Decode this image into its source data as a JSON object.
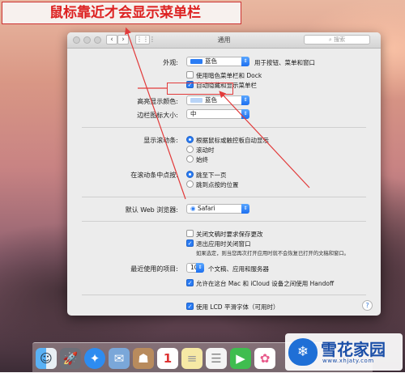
{
  "annotation": {
    "banner_text": "鼠标靠近才会显示菜单栏"
  },
  "window": {
    "title": "通用",
    "search_placeholder": "搜索"
  },
  "appearance": {
    "label": "外观:",
    "value": "蓝色",
    "hint": "用于按钮、菜单和窗口",
    "accent": "#2a7cf4"
  },
  "dark_menu_checkbox": {
    "label": "使用暗色菜单栏和 Dock",
    "checked": false
  },
  "autohide_checkbox": {
    "label": "自动隐藏和显示菜单栏",
    "checked": true
  },
  "highlight": {
    "label": "高亮显示颜色:",
    "value": "蓝色",
    "swatch": "#b9d4f7"
  },
  "sidebar_icon_size": {
    "label": "边栏图标大小:",
    "value": "中"
  },
  "scrollbars": {
    "label": "显示滚动条:",
    "options": [
      "根据鼠标或触控板自动显示",
      "滚动时",
      "始终"
    ],
    "selected": 0
  },
  "click_scrollbar": {
    "label": "在滚动条中点按:",
    "options": [
      "跳至下一页",
      "跳到点按的位置"
    ],
    "selected": 0
  },
  "browser": {
    "label": "默认 Web 浏览器:",
    "value": "Safari"
  },
  "ask_keep_changes": {
    "label": "关闭文稿时要求保存更改",
    "checked": false
  },
  "close_windows": {
    "label": "退出应用时关闭窗口",
    "checked": true,
    "note": "如果选定，则当您再次打开应用时就不会恢复已打开的文稿和窗口。"
  },
  "recent_items": {
    "label": "最近使用的项目:",
    "value": "10",
    "suffix": "个文稿、应用和服务器"
  },
  "handoff": {
    "label": "允许在这台 Mac 和 iCloud 设备之间使用 Handoff",
    "checked": true
  },
  "lcd_smoothing": {
    "label": "使用 LCD 平滑字体（可用时）",
    "checked": true
  },
  "help_button": {
    "label": "?"
  },
  "dock": {
    "icons": [
      "finder-icon",
      "launchpad-icon",
      "safari-icon",
      "mail-icon",
      "contacts-icon",
      "calendar-icon",
      "notes-icon",
      "reminders-icon",
      "facetime-icon",
      "photos-icon"
    ],
    "calendar_day": "1"
  },
  "watermark": {
    "brand": "雪花家园",
    "url": "www.xhjaty.com"
  }
}
